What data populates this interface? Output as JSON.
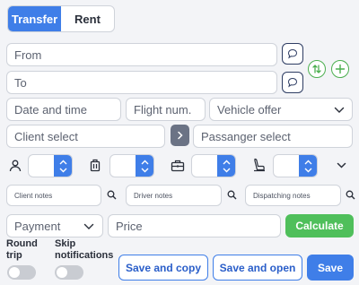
{
  "tabs": {
    "transfer": "Transfer",
    "rent": "Rent"
  },
  "route": {
    "from_placeholder": "From",
    "to_placeholder": "To"
  },
  "details": {
    "date_placeholder": "Date and time",
    "flight_placeholder": "Flight num.",
    "vehicle_selected": "Vehicle offer",
    "client_placeholder": "Client select",
    "passenger_placeholder": "Passanger select"
  },
  "counters": {
    "passengers": "",
    "luggage": "",
    "briefcases": "",
    "child_seats": ""
  },
  "notes": {
    "client_placeholder": "Client notes",
    "driver_placeholder": "Driver notes",
    "dispatching_placeholder": "Dispatching notes"
  },
  "pricing": {
    "payment_selected": "Payment",
    "price_placeholder": "Price",
    "calculate_label": "Calculate"
  },
  "options": {
    "round_trip_label": "Round trip",
    "skip_notifications_label": "Skip notifications"
  },
  "actions": {
    "save_copy_label": "Save and copy",
    "save_open_label": "Save and open",
    "save_label": "Save"
  },
  "colors": {
    "accent": "#3f7ee8",
    "green": "#4fbf5b",
    "dark_button": "#6b7385",
    "border": "#cfd3da"
  }
}
